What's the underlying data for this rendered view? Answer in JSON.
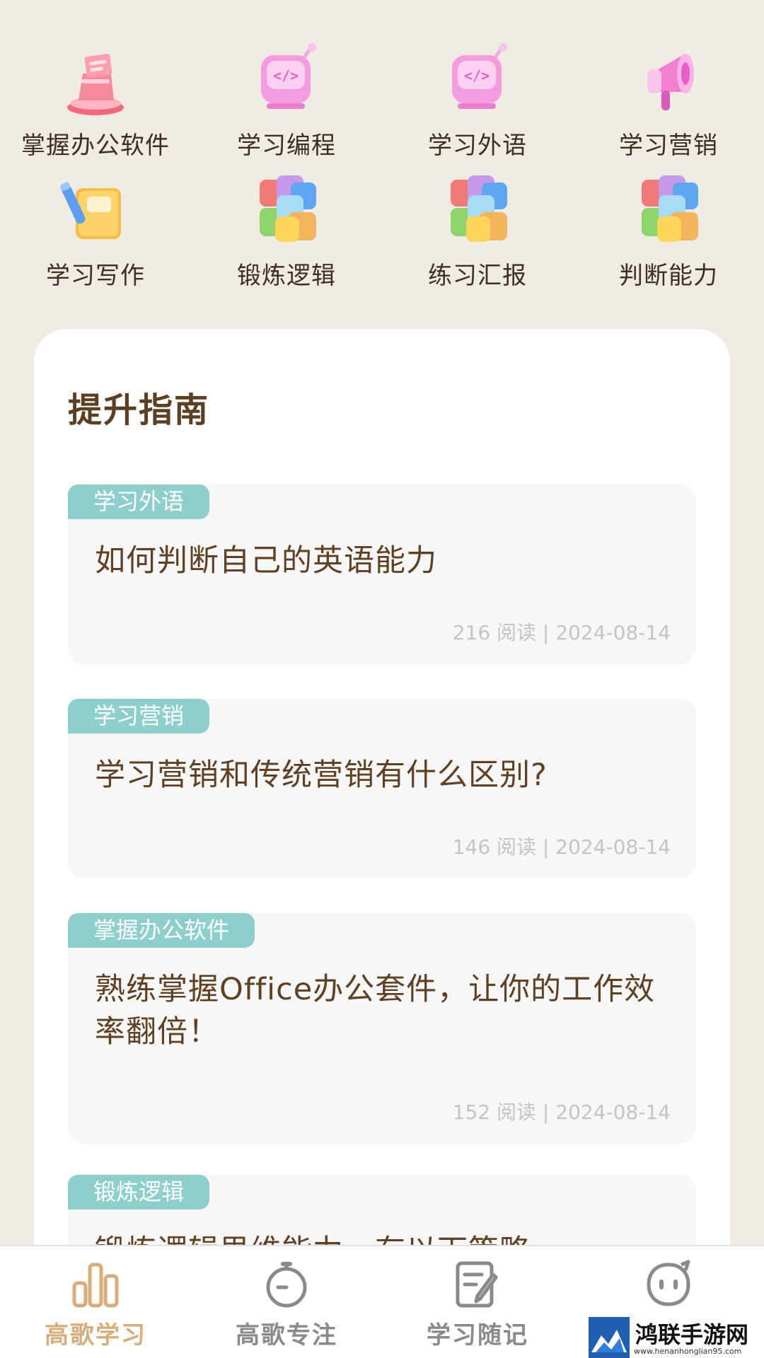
{
  "categories": [
    {
      "label": "掌握办公软件",
      "icon": "office-icon"
    },
    {
      "label": "学习编程",
      "icon": "code-icon"
    },
    {
      "label": "学习外语",
      "icon": "code-icon"
    },
    {
      "label": "学习营销",
      "icon": "megaphone-icon"
    },
    {
      "label": "学习写作",
      "icon": "notebook-pen-icon"
    },
    {
      "label": "锻炼逻辑",
      "icon": "cube-icon"
    },
    {
      "label": "练习汇报",
      "icon": "cube-icon"
    },
    {
      "label": "判断能力",
      "icon": "cube-icon"
    }
  ],
  "guide": {
    "title": "提升指南",
    "articles": [
      {
        "tag": "学习外语",
        "title": "如何判断自己的英语能力",
        "meta": "216 阅读 | 2024-08-14"
      },
      {
        "tag": "学习营销",
        "title": "学习营销和传统营销有什么区别?",
        "meta": "146 阅读 | 2024-08-14"
      },
      {
        "tag": "掌握办公软件",
        "title": "熟练掌握Office办公套件，让你的工作效率翻倍！",
        "meta": "152 阅读 | 2024-08-14"
      },
      {
        "tag": "锻炼逻辑",
        "title": "锻炼逻辑思维能力，有以下策略",
        "meta": ""
      }
    ]
  },
  "nav": [
    {
      "label": "高歌学习",
      "icon": "bar-chart-icon",
      "active": true
    },
    {
      "label": "高歌专注",
      "icon": "stopwatch-icon",
      "active": false
    },
    {
      "label": "学习随记",
      "icon": "note-edit-icon",
      "active": false
    },
    {
      "label": "",
      "icon": "chat-face-icon",
      "active": false
    }
  ],
  "watermark": {
    "title": "鸿联手游网",
    "url": "www.henanhonglian95.com"
  },
  "colors": {
    "background": "#f0ebe3",
    "accent": "#d7ad7b",
    "tag": "#8fcfcb",
    "title_text": "#5a3f22",
    "nav_inactive": "#8a8a8a"
  }
}
